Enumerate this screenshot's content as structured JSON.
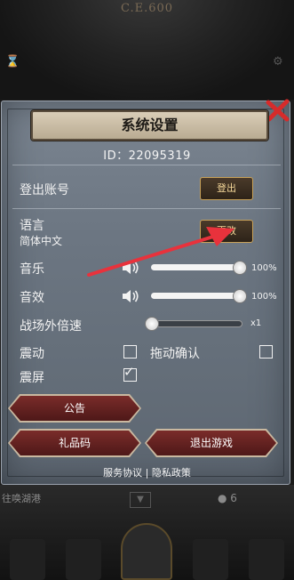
{
  "background": {
    "era": "C.E.600",
    "port_text": "往唤湖港",
    "coin_count": "6"
  },
  "dialog": {
    "title": "系统设置",
    "id_text": "ID：22095319",
    "account": {
      "label": "登出账号",
      "button": "登出"
    },
    "language": {
      "label": "语言",
      "value": "简体中文",
      "button": "更改"
    },
    "music": {
      "label": "音乐",
      "level_percent": 100,
      "value_text": "100%"
    },
    "sound": {
      "label": "音效",
      "level_percent": 100,
      "value_text": "100%"
    },
    "speed": {
      "label": "战场外倍速",
      "value_text": "x1"
    },
    "vibration": {
      "label": "震动",
      "checked": false
    },
    "drag_confirm": {
      "label": "拖动确认",
      "checked": false
    },
    "shake": {
      "label": "震屏",
      "checked": true
    },
    "buttons": {
      "notice": "公告",
      "gift_code": "礼品码",
      "exit": "退出游戏"
    },
    "links": {
      "terms": "服务协议",
      "divider": "|",
      "privacy": "隐私政策"
    }
  },
  "colors": {
    "close_x": "#d62b2b",
    "annotation_arrow": "#e8323c",
    "button_gold": "#c8a25a",
    "button_red": "#7a2c2a"
  }
}
